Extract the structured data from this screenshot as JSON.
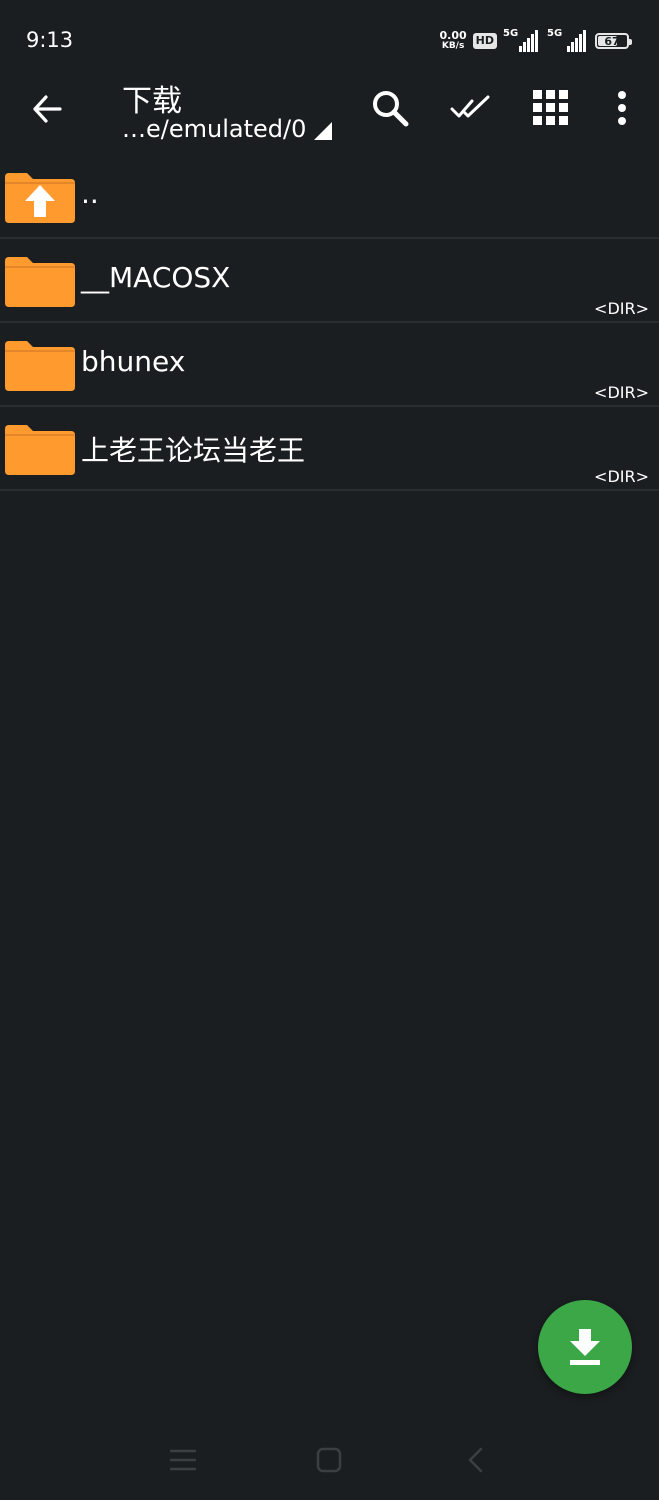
{
  "status_bar": {
    "time": "9:13",
    "net_speed_value": "0.00",
    "net_speed_unit": "KB/s",
    "hd_label": "HD",
    "signal1_label": "5G",
    "signal2_label": "5G",
    "battery": "67"
  },
  "toolbar": {
    "title": "下载",
    "path": "…e/emulated/0",
    "icons": [
      "back-arrow-icon",
      "search-icon",
      "double-check-icon",
      "grid-icon",
      "more-vert-icon"
    ]
  },
  "files": [
    {
      "name": "..",
      "meta": "",
      "type": "parent"
    },
    {
      "name": "__MACOSX",
      "meta": "<DIR>",
      "type": "folder"
    },
    {
      "name": "bhunex",
      "meta": "<DIR>",
      "type": "folder"
    },
    {
      "name": "上老王论坛当老王",
      "meta": "<DIR>",
      "type": "folder"
    }
  ],
  "colors": {
    "background": "#1b1e20",
    "folder": "#ff9a2e",
    "fab": "#3ba747",
    "divider": "#2a2e31"
  },
  "fab": {
    "icon": "download-icon"
  },
  "nav_bar": {
    "icons": [
      "menu-icon",
      "home-icon",
      "back-icon"
    ]
  }
}
